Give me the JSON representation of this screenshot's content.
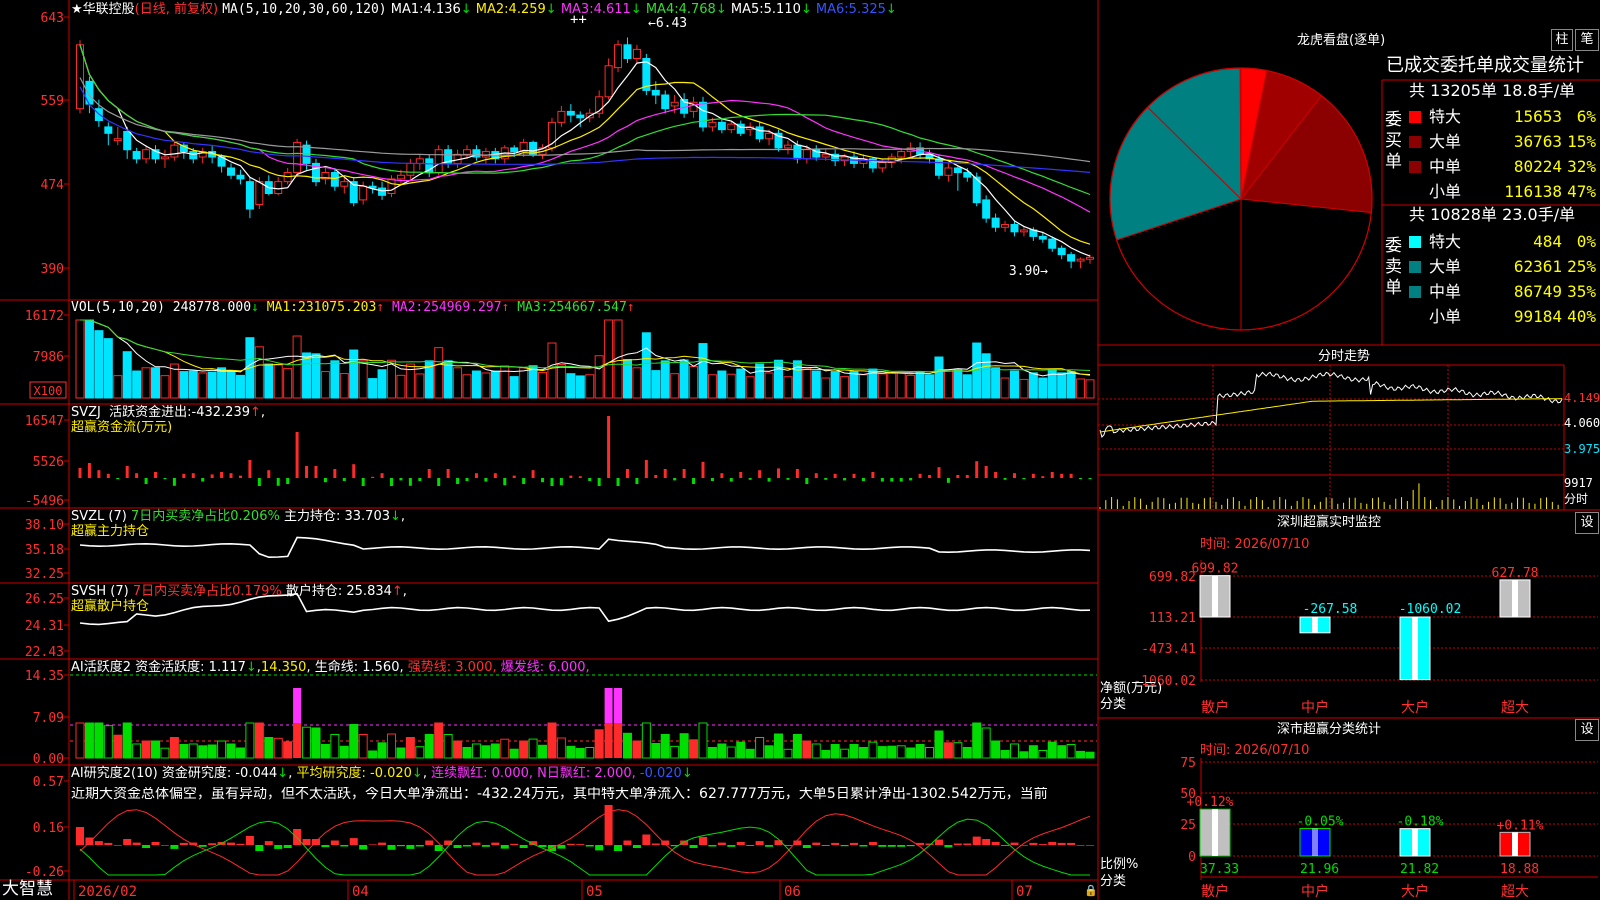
{
  "stock": {
    "name": "华联控股",
    "mode": "(日线, 前复权)",
    "star": "★"
  },
  "app_name": "大智慧",
  "colors": {
    "up": "#ff2a2a",
    "down": "#00e5ff",
    "ma1": "#ffffff",
    "ma2": "#ffee00",
    "ma3": "#ff33ff",
    "ma4": "#33dd33",
    "ma5": "#9a9a9a",
    "ma6": "#3333ff",
    "green": "#00dd00",
    "frame": "#cc0000",
    "yellow": "#ffff00",
    "magenta": "#ff33ff",
    "teal": "#008080",
    "darkred": "#8b0000"
  },
  "main_chart": {
    "ma_header": "MA(5,10,20,30,60,120)",
    "ma_values": [
      {
        "name": "MA1:",
        "value": "4.136",
        "arrow": "↓"
      },
      {
        "name": "MA2:",
        "value": "4.259",
        "arrow": "↓"
      },
      {
        "name": "MA3:",
        "value": "4.611",
        "arrow": "↓"
      },
      {
        "name": "MA4:",
        "value": "4.768",
        "arrow": "↓"
      },
      {
        "name": "MA5:",
        "value": "5.110",
        "arrow": "↓"
      },
      {
        "name": "MA6:",
        "value": "5.325",
        "arrow": "↓"
      }
    ],
    "y_ticks": [
      "643",
      "559",
      "474",
      "390"
    ],
    "high_mark": "6.43",
    "low_mark": "3.90",
    "signal_mark": "++",
    "y_range": [
      3.75,
      6.6
    ],
    "candles": [
      [
        5.65,
        6.35,
        5.6,
        6.4
      ],
      [
        5.95,
        5.7,
        5.6,
        6.0
      ],
      [
        5.65,
        5.52,
        5.45,
        5.75
      ],
      [
        5.45,
        5.38,
        5.25,
        5.5
      ],
      [
        5.3,
        5.32,
        5.25,
        5.45
      ],
      [
        5.4,
        5.2,
        5.1,
        5.45
      ],
      [
        5.18,
        5.1,
        5.05,
        5.22
      ],
      [
        5.1,
        5.2,
        5.05,
        5.25
      ],
      [
        5.2,
        5.1,
        5.05,
        5.25
      ],
      [
        5.1,
        5.12,
        5.0,
        5.2
      ],
      [
        5.12,
        5.25,
        5.08,
        5.3
      ],
      [
        5.25,
        5.18,
        5.1,
        5.28
      ],
      [
        5.18,
        5.1,
        5.05,
        5.22
      ],
      [
        5.12,
        5.18,
        5.05,
        5.22
      ],
      [
        5.18,
        5.12,
        5.05,
        5.24
      ],
      [
        5.12,
        5.02,
        4.95,
        5.15
      ],
      [
        5.0,
        4.92,
        4.88,
        5.05
      ],
      [
        4.92,
        4.88,
        4.82,
        4.98
      ],
      [
        4.85,
        4.55,
        4.45,
        4.9
      ],
      [
        4.6,
        4.85,
        4.55,
        4.9
      ],
      [
        4.85,
        4.72,
        4.7,
        4.92
      ],
      [
        4.72,
        4.85,
        4.7,
        4.9
      ],
      [
        4.85,
        4.95,
        4.82,
        5.0
      ],
      [
        4.95,
        5.28,
        4.9,
        5.32
      ],
      [
        5.25,
        5.05,
        4.98,
        5.3
      ],
      [
        5.05,
        4.85,
        4.8,
        5.1
      ],
      [
        4.88,
        4.95,
        4.82,
        5.0
      ],
      [
        4.95,
        4.8,
        4.75,
        5.0
      ],
      [
        4.8,
        4.85,
        4.72,
        4.9
      ],
      [
        4.85,
        4.62,
        4.58,
        4.9
      ],
      [
        4.65,
        4.8,
        4.6,
        4.85
      ],
      [
        4.8,
        4.78,
        4.72,
        4.85
      ],
      [
        4.78,
        4.7,
        4.65,
        4.85
      ],
      [
        4.72,
        4.88,
        4.68,
        4.92
      ],
      [
        4.88,
        4.92,
        4.82,
        4.98
      ],
      [
        4.92,
        5.05,
        4.88,
        5.1
      ],
      [
        5.05,
        5.1,
        4.98,
        5.15
      ],
      [
        5.1,
        4.95,
        4.9,
        5.15
      ],
      [
        4.95,
        5.2,
        4.92,
        5.25
      ],
      [
        5.2,
        5.05,
        5.0,
        5.25
      ],
      [
        5.05,
        5.15,
        5.0,
        5.2
      ],
      [
        5.15,
        5.2,
        5.1,
        5.25
      ],
      [
        5.2,
        5.12,
        5.08,
        5.25
      ],
      [
        5.12,
        5.18,
        5.05,
        5.22
      ],
      [
        5.18,
        5.1,
        5.05,
        5.22
      ],
      [
        5.1,
        5.22,
        5.05,
        5.25
      ],
      [
        5.22,
        5.18,
        5.12,
        5.25
      ],
      [
        5.18,
        5.28,
        5.12,
        5.32
      ],
      [
        5.28,
        5.15,
        5.12,
        5.3
      ],
      [
        5.15,
        5.22,
        5.1,
        5.26
      ],
      [
        5.22,
        5.5,
        5.18,
        5.55
      ],
      [
        5.5,
        5.62,
        5.45,
        5.68
      ],
      [
        5.62,
        5.58,
        5.5,
        5.7
      ],
      [
        5.58,
        5.55,
        5.45,
        5.62
      ],
      [
        5.55,
        5.6,
        5.5,
        5.65
      ],
      [
        5.6,
        5.78,
        5.55,
        5.85
      ],
      [
        5.78,
        6.12,
        5.75,
        6.2
      ],
      [
        6.1,
        6.35,
        6.05,
        6.4
      ],
      [
        6.35,
        6.2,
        6.15,
        6.43
      ],
      [
        6.2,
        6.3,
        6.15,
        6.35
      ],
      [
        6.2,
        5.85,
        5.8,
        6.25
      ],
      [
        5.85,
        5.8,
        5.7,
        5.95
      ],
      [
        5.8,
        5.65,
        5.6,
        5.85
      ],
      [
        5.68,
        5.72,
        5.6,
        5.8
      ],
      [
        5.75,
        5.6,
        5.55,
        5.82
      ],
      [
        5.62,
        5.72,
        5.55,
        5.78
      ],
      [
        5.72,
        5.45,
        5.4,
        5.78
      ],
      [
        5.45,
        5.5,
        5.4,
        5.55
      ],
      [
        5.5,
        5.42,
        5.38,
        5.55
      ],
      [
        5.42,
        5.48,
        5.38,
        5.52
      ],
      [
        5.48,
        5.38,
        5.35,
        5.52
      ],
      [
        5.42,
        5.45,
        5.35,
        5.5
      ],
      [
        5.45,
        5.32,
        5.28,
        5.5
      ],
      [
        5.32,
        5.38,
        5.25,
        5.42
      ],
      [
        5.38,
        5.22,
        5.18,
        5.42
      ],
      [
        5.22,
        5.25,
        5.15,
        5.3
      ],
      [
        5.25,
        5.1,
        5.05,
        5.3
      ],
      [
        5.1,
        5.2,
        5.05,
        5.25
      ],
      [
        5.2,
        5.12,
        5.08,
        5.25
      ],
      [
        5.12,
        5.15,
        5.08,
        5.2
      ],
      [
        5.15,
        5.08,
        5.02,
        5.2
      ],
      [
        5.08,
        5.12,
        5.02,
        5.15
      ],
      [
        5.12,
        5.05,
        5.0,
        5.18
      ],
      [
        5.05,
        5.1,
        5.0,
        5.15
      ],
      [
        5.1,
        5.0,
        4.95,
        5.12
      ],
      [
        5.0,
        5.06,
        4.95,
        5.1
      ],
      [
        5.06,
        5.12,
        5.0,
        5.16
      ],
      [
        5.12,
        5.18,
        5.05,
        5.22
      ],
      [
        5.18,
        5.22,
        5.12,
        5.28
      ],
      [
        5.22,
        5.15,
        5.1,
        5.28
      ],
      [
        5.15,
        5.1,
        5.05,
        5.2
      ],
      [
        5.1,
        4.92,
        4.88,
        5.15
      ],
      [
        4.92,
        5.0,
        4.85,
        5.05
      ],
      [
        5.0,
        4.95,
        4.75,
        5.02
      ],
      [
        4.95,
        4.9,
        4.85,
        5.0
      ],
      [
        4.9,
        4.62,
        4.58,
        4.95
      ],
      [
        4.65,
        4.45,
        4.4,
        4.7
      ],
      [
        4.45,
        4.35,
        4.3,
        4.5
      ],
      [
        4.35,
        4.38,
        4.3,
        4.42
      ],
      [
        4.38,
        4.3,
        4.25,
        4.42
      ],
      [
        4.3,
        4.32,
        4.25,
        4.36
      ],
      [
        4.32,
        4.25,
        4.2,
        4.35
      ],
      [
        4.25,
        4.22,
        4.18,
        4.3
      ],
      [
        4.22,
        4.12,
        4.08,
        4.25
      ],
      [
        4.12,
        4.05,
        4.0,
        4.15
      ],
      [
        4.05,
        3.98,
        3.9,
        4.08
      ],
      [
        3.98,
        4.0,
        3.9,
        4.02
      ],
      [
        4.0,
        4.02,
        3.95,
        4.05
      ]
    ]
  },
  "vol": {
    "header": "VOL(5,10,20)",
    "value": "248778.000",
    "arrow": "↓",
    "ma": [
      {
        "name": "MA1:",
        "value": "231075.203",
        "arrow": "↑"
      },
      {
        "name": "MA2:",
        "value": "254969.297",
        "arrow": "↑"
      },
      {
        "name": "MA3:",
        "value": "254667.547",
        "arrow": "↑"
      }
    ],
    "y_ticks": [
      "16172",
      "7986"
    ],
    "unit": "X100"
  },
  "svzj": {
    "header": "SVZJ",
    "title": "活跃资金进出:",
    "value": "-432.239",
    "arrow": "↑",
    "subtitle": "超赢资金流(万元)",
    "y_ticks": [
      "16547",
      "5526",
      "-5496"
    ]
  },
  "svzl": {
    "header": "SVZL (7)",
    "title": "7日内买卖净占比0.206%",
    "label2": "主力持仓:",
    "value": "33.703",
    "arrow": "↓",
    "subtitle": "超赢主力持仓",
    "y_ticks": [
      "38.10",
      "35.18",
      "32.25"
    ]
  },
  "svsh": {
    "header": "SVSH (7)",
    "title": "7日内买卖净占比0.179%",
    "label2": "散户持仓:",
    "value": "25.834",
    "arrow": "↑",
    "subtitle": "超赢散户持仓",
    "y_ticks": [
      "26.25",
      "24.31",
      "22.43"
    ]
  },
  "ai1": {
    "header": "AI活跃度2",
    "label1": "资金活跃度:",
    "value1": "1.117",
    "arrow1": "↓",
    "value1b": "14.350",
    "label2": "生命线:",
    "value2": "1.560",
    "label3": "强势线:",
    "value3": "3.000",
    "label4": "爆发线:",
    "value4": "6.000",
    "y_ticks": [
      "14.35",
      "7.09",
      "0.00"
    ]
  },
  "ai2": {
    "header": "AI研究度2(10)",
    "label1": "资金研究度:",
    "value1": "-0.044",
    "arrow1": "↓",
    "label2": "平均研究度:",
    "value2": "-0.020",
    "arrow2": "↓",
    "label3": "连续飘红:",
    "value3": "0.000",
    "label4": "N日飘红:",
    "value4": "2.000",
    "value5": "-0.020",
    "arrow5": "↓",
    "note": "近期大资金总体偏空，虽有异动，但不太活跃，今日大单净流出：-432.24万元，其中特大单净流入：627.777万元，大单5日累计净出-1302.542万元，当前",
    "y_ticks": [
      "0.57",
      "0.16",
      "-0.26"
    ]
  },
  "x_axis": {
    "labels": [
      "2026/02",
      "04",
      "05",
      "06",
      "07"
    ]
  },
  "right": {
    "lhb": {
      "title": "龙虎看盘(逐单)",
      "tab1": "柱",
      "tab2": "笔",
      "header": "已成交委托单成交量统计",
      "buy": {
        "side": "委买单",
        "total": "共 13205单 18.8手/单",
        "rows": [
          {
            "label": "特大",
            "vol": "15653",
            "pct": "6%"
          },
          {
            "label": "大单",
            "vol": "36763",
            "pct": "15%"
          },
          {
            "label": "中单",
            "vol": "80224",
            "pct": "32%"
          },
          {
            "label": "小单",
            "vol": "116138",
            "pct": "47%"
          }
        ]
      },
      "sell": {
        "side": "委卖单",
        "total": "共 10828单 23.0手/单",
        "rows": [
          {
            "label": "特大",
            "vol": "484",
            "pct": "0%"
          },
          {
            "label": "大单",
            "vol": "62361",
            "pct": "25%"
          },
          {
            "label": "中单",
            "vol": "86749",
            "pct": "35%"
          },
          {
            "label": "小单",
            "vol": "99184",
            "pct": "40%"
          }
        ]
      }
    },
    "fenshi": {
      "title": "分时走势",
      "y_ticks": [
        "4.149",
        "4.060",
        "3.975"
      ],
      "vol_tick": "9917",
      "vol_unit": "分时"
    },
    "szcy": {
      "title": "深圳超赢实时监控",
      "set": "设",
      "time": "时间: 2026/07/10",
      "y_ticks": [
        "699.82",
        "113.21",
        "-473.41",
        "-1060.02"
      ],
      "unit1": "净额(万元)",
      "unit2": "分类",
      "cats": [
        "散户",
        "中户",
        "大户",
        "超大"
      ],
      "values": [
        699.82,
        -267.58,
        -1060.02,
        627.78
      ],
      "value_labels": [
        "699.82",
        "-267.58",
        "-1060.02",
        "627.78"
      ]
    },
    "sccy": {
      "title": "深市超赢分类统计",
      "set": "设",
      "time": "时间: 2026/07/10",
      "y_ticks": [
        "75",
        "50",
        "25",
        "0"
      ],
      "unit1": "比例%",
      "unit2": "分类",
      "cats": [
        "散户",
        "中户",
        "大户",
        "超大"
      ],
      "values": [
        37.33,
        21.96,
        21.82,
        18.88
      ],
      "value_labels": [
        "37.33",
        "21.96",
        "21.82",
        "18.88"
      ],
      "delta_labels": [
        "+0.12%",
        "-0.05%",
        "-0.18%",
        "+0.11%"
      ]
    }
  },
  "chart_data": [
    {
      "type": "line",
      "title": "华联控股",
      "xlabel": "",
      "ylabel": "",
      "x_labels": [
        "2026/02",
        "04",
        "05",
        "06",
        "07"
      ],
      "ylim": [
        3.75,
        6.6
      ],
      "series": [
        {
          "name": "MA1",
          "values": [
            4.136
          ]
        },
        {
          "name": "MA2",
          "values": [
            4.259
          ]
        },
        {
          "name": "MA3",
          "values": [
            4.611
          ]
        },
        {
          "name": "MA4",
          "values": [
            4.768
          ]
        },
        {
          "name": "MA5",
          "values": [
            5.11
          ]
        },
        {
          "name": "MA6",
          "values": [
            5.325
          ]
        }
      ]
    },
    {
      "type": "pie",
      "title": "龙虎看盘(逐单)",
      "categories": [
        "委买特大",
        "委买大单",
        "委买中单",
        "委买小单",
        "委卖特大",
        "委卖大单",
        "委卖中单",
        "委卖小单"
      ],
      "values": [
        15653,
        36763,
        80224,
        116138,
        484,
        62361,
        86749,
        99184
      ]
    },
    {
      "type": "bar",
      "title": "深圳超赢实时监控",
      "categories": [
        "散户",
        "中户",
        "大户",
        "超大"
      ],
      "values": [
        699.82,
        -267.58,
        -1060.02,
        627.78
      ],
      "ylabel": "净额(万元)"
    },
    {
      "type": "bar",
      "title": "深市超赢分类统计",
      "categories": [
        "散户",
        "中户",
        "大户",
        "超大"
      ],
      "values": [
        37.33,
        21.96,
        21.82,
        18.88
      ],
      "ylabel": "比例%",
      "ylim": [
        0,
        75
      ]
    }
  ]
}
